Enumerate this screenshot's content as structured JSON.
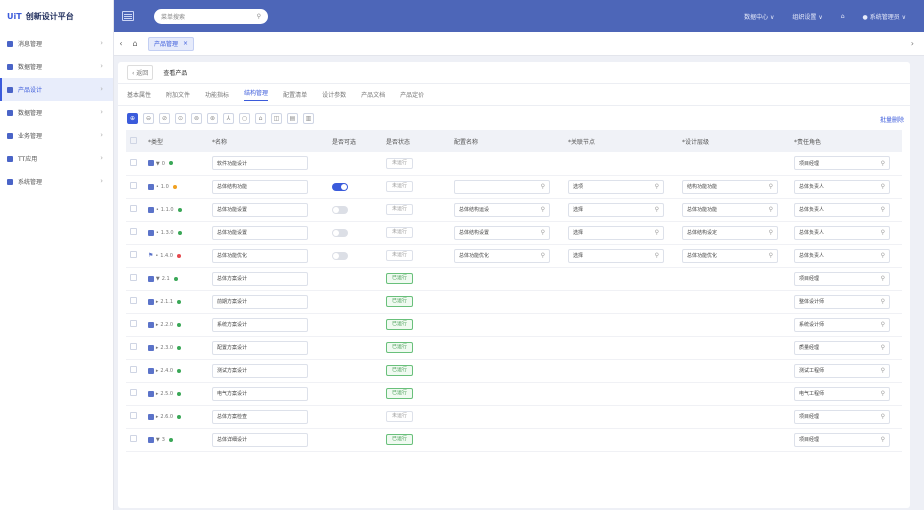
{
  "app": {
    "logo_mark": "UiT",
    "title": "创新设计平台"
  },
  "sidebar": {
    "items": [
      {
        "label": "消息管理",
        "active": false
      },
      {
        "label": "数据管理",
        "active": false
      },
      {
        "label": "产品设计",
        "active": true
      },
      {
        "label": "数据管理",
        "active": false
      },
      {
        "label": "业务管理",
        "active": false
      },
      {
        "label": "TT应用",
        "active": false
      },
      {
        "label": "系统管理",
        "active": false
      }
    ]
  },
  "topbar": {
    "search_placeholder": "菜单搜索",
    "right": [
      {
        "label": "数据中心 ∨"
      },
      {
        "label": "组织设置 ∨"
      },
      {
        "label": "⌂"
      },
      {
        "label": "● 系统管理员 ∨"
      }
    ]
  },
  "tabsbar": {
    "back": "‹",
    "home": "⌂",
    "tab_label": "产品管理",
    "tab_close": "×",
    "next": "›"
  },
  "breadcrumb": {
    "back_label": "‹ 返回",
    "title": "查看产品"
  },
  "subtabs": [
    "基本属性",
    "附加文件",
    "功能指标",
    "结构管理",
    "配置清单",
    "设计参数",
    "产品文档",
    "产品定价"
  ],
  "subtab_active_index": 3,
  "toolbar": {
    "icons": [
      "⊕",
      "⊖",
      "⊘",
      "⊙",
      "⊚",
      "⊛",
      "⅄",
      "○",
      "⌂",
      "◫",
      "▤",
      "▥"
    ],
    "link": "批量删除"
  },
  "table": {
    "headers": [
      "",
      "*类型",
      "*名称",
      "是否可选",
      "是否状态",
      "配置名称",
      "*关联节点",
      "*设计层级",
      "*责任角色"
    ],
    "rows": [
      {
        "expand": "▼",
        "code": "0",
        "dot": "#3aa757",
        "name": "软件功能设计",
        "toggle": null,
        "status": "未运行",
        "status_ok": false,
        "cfg": "",
        "node": "",
        "level": "",
        "role": "项目经理",
        "type": "doc"
      },
      {
        "expand": "•",
        "code": "1.0",
        "dot": "#f0a020",
        "name": "总体结构功能",
        "toggle": "on",
        "status": "未运行",
        "status_ok": false,
        "cfg": " ",
        "node": "选项",
        "level": "结构功能功能",
        "role": "总体负责人",
        "type": "doc"
      },
      {
        "expand": "•",
        "code": "1.1.0",
        "dot": "#3aa757",
        "name": "总体功能设置",
        "toggle": "off",
        "status": "未运行",
        "status_ok": false,
        "cfg": "总体结构运设",
        "node": "选择",
        "level": "总体功能功能",
        "role": "总体负责人",
        "type": "doc"
      },
      {
        "expand": "•",
        "code": "1.3.0",
        "dot": "#3aa757",
        "name": "总体功能设置",
        "toggle": "off",
        "status": "未运行",
        "status_ok": false,
        "cfg": "总体结构设置",
        "node": "选择",
        "level": "总体结构设定",
        "role": "总体负责人",
        "type": "doc"
      },
      {
        "expand": "•",
        "code": "1.4.0",
        "dot": "#e5484d",
        "name": "总体功能优化",
        "toggle": "off",
        "status": "未运行",
        "status_ok": false,
        "cfg": "总体功能优化",
        "node": "选择",
        "level": "总体功能优化",
        "role": "总体负责人",
        "type": "flag"
      },
      {
        "expand": "▼",
        "code": "2.1",
        "dot": "#3aa757",
        "name": "总体方案设计",
        "toggle": null,
        "status": "已运行",
        "status_ok": true,
        "cfg": "",
        "node": "",
        "level": "",
        "role": "项目经理",
        "type": "doc"
      },
      {
        "expand": "▸",
        "code": "2.1.1",
        "dot": "#3aa757",
        "name": "前期方案设计",
        "toggle": null,
        "status": "已运行",
        "status_ok": true,
        "cfg": "",
        "node": "",
        "level": "",
        "role": "整体设计师",
        "type": "doc"
      },
      {
        "expand": "▸",
        "code": "2.2.0",
        "dot": "#3aa757",
        "name": "系统方案设计",
        "toggle": null,
        "status": "已运行",
        "status_ok": true,
        "cfg": "",
        "node": "",
        "level": "",
        "role": "系统设计师",
        "type": "doc"
      },
      {
        "expand": "▸",
        "code": "2.3.0",
        "dot": "#3aa757",
        "name": "配置方案设计",
        "toggle": null,
        "status": "已运行",
        "status_ok": true,
        "cfg": "",
        "node": "",
        "level": "",
        "role": "质量经理",
        "type": "doc"
      },
      {
        "expand": "▸",
        "code": "2.4.0",
        "dot": "#3aa757",
        "name": "测试方案设计",
        "toggle": null,
        "status": "已运行",
        "status_ok": true,
        "cfg": "",
        "node": "",
        "level": "",
        "role": "测试工程师",
        "type": "doc"
      },
      {
        "expand": "▸",
        "code": "2.5.0",
        "dot": "#3aa757",
        "name": "电气方案设计",
        "toggle": null,
        "status": "已运行",
        "status_ok": true,
        "cfg": "",
        "node": "",
        "level": "",
        "role": "电气工程师",
        "type": "doc"
      },
      {
        "expand": "▸",
        "code": "2.6.0",
        "dot": "#3aa757",
        "name": "总体方案检查",
        "toggle": null,
        "status": "未运行",
        "status_ok": false,
        "cfg": "",
        "node": "",
        "level": "",
        "role": "项目经理",
        "type": "doc"
      },
      {
        "expand": "▼",
        "code": "3",
        "dot": "#3aa757",
        "name": "总体详细设计",
        "toggle": null,
        "status": "已运行",
        "status_ok": true,
        "cfg": "",
        "node": "",
        "level": "",
        "role": "项目经理",
        "type": "doc"
      }
    ]
  },
  "colors": {
    "accent": "#3b5bdb",
    "topbar": "#4d66b8"
  }
}
